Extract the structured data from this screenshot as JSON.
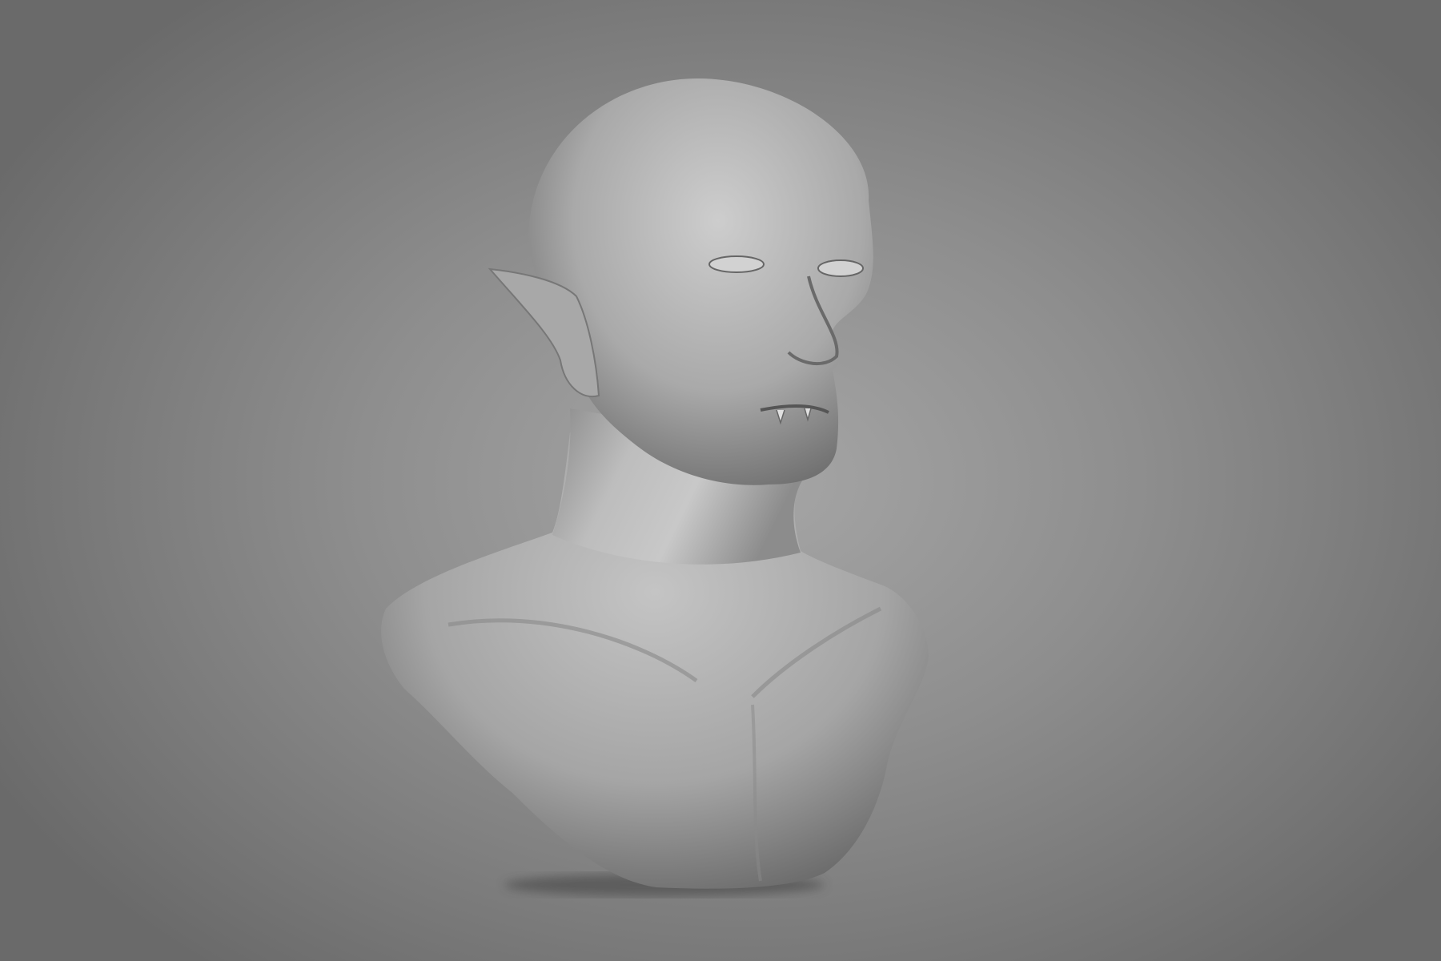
{
  "scene": {
    "subject": "sculpted-bust",
    "colors": {
      "background_center": "#a6a6a6",
      "background_edge": "#6a6a6a",
      "material_light": "#cfcfcf",
      "material_dark": "#5a5a5a"
    }
  }
}
